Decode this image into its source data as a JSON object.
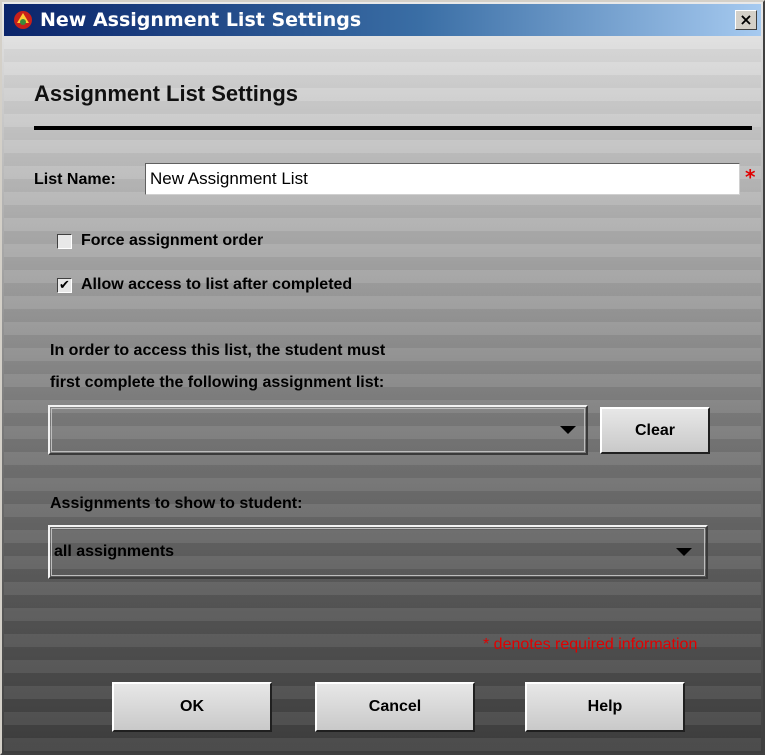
{
  "window": {
    "title": "New Assignment List Settings",
    "close_glyph": "×"
  },
  "heading": "Assignment List Settings",
  "list_name": {
    "label": "List Name:",
    "value": "New Assignment List",
    "required_marker": "*"
  },
  "options": [
    {
      "label": "Force assignment order",
      "checked": false
    },
    {
      "label": "Allow access to list after completed",
      "checked": true
    }
  ],
  "checkmark_glyph": "✔",
  "prerequisite": {
    "text_line1": "In order to access this list, the student must",
    "text_line2": "first complete the following assignment list:",
    "selected": "",
    "clear_label": "Clear"
  },
  "show_assignments": {
    "label": "Assignments to show to student:",
    "selected": "all assignments"
  },
  "required_note": "* denotes required information",
  "buttons": {
    "ok": "OK",
    "cancel": "Cancel",
    "help": "Help"
  },
  "colors": {
    "title_start": "#0a246a",
    "title_end": "#a6caf0",
    "required": "#e00000"
  },
  "icons": {
    "app": "app-logo-icon",
    "close": "close-icon",
    "dropdown": "chevron-down-icon"
  }
}
